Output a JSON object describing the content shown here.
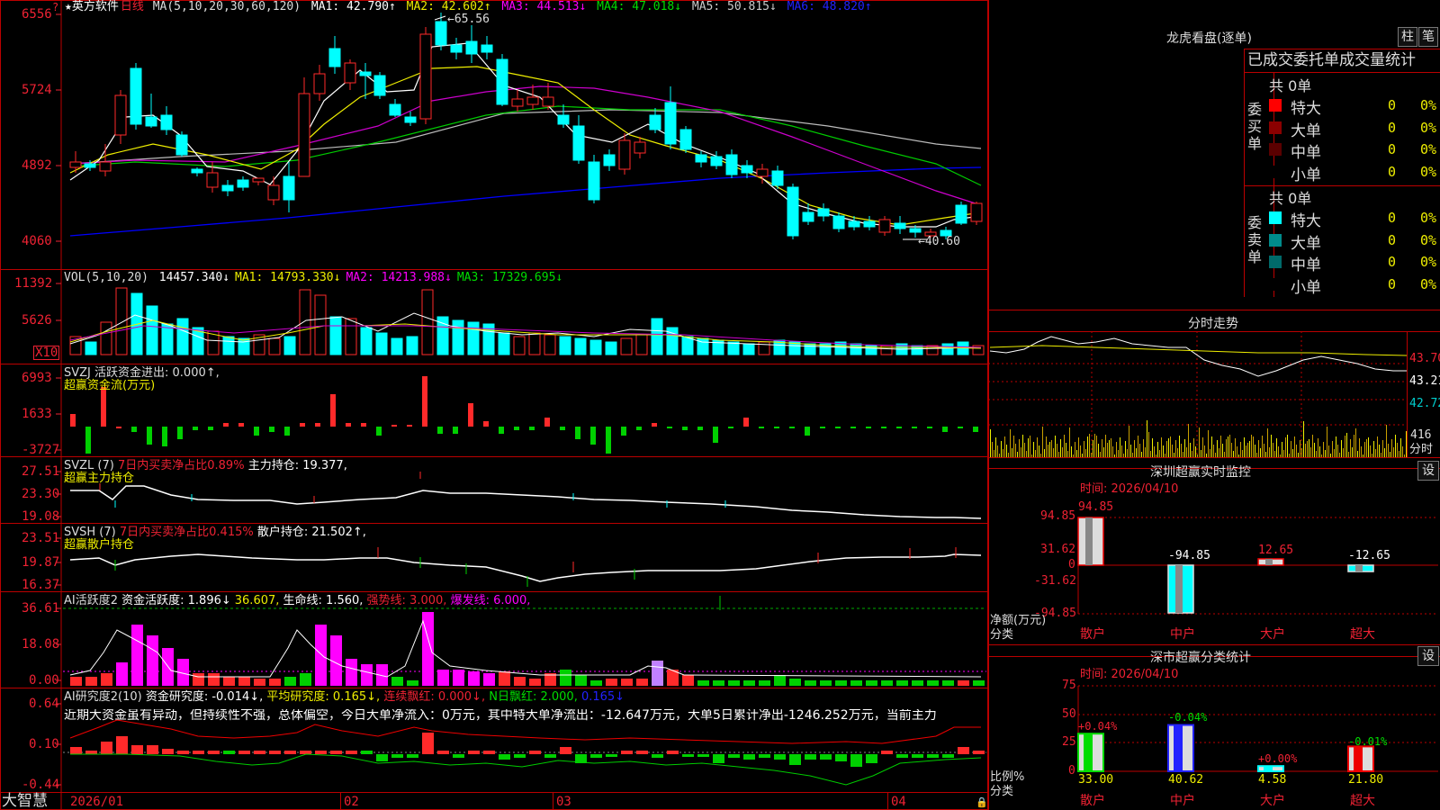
{
  "header": {
    "star": "★",
    "stock_name": "英方软件",
    "period": "日线",
    "ma_text": "MA(5,10,20,30,60,120)",
    "ma1": "MA1: 42.790↑",
    "ma2": "MA2: 42.602↑",
    "ma3": "MA3: 44.513↓",
    "ma4": "MA4: 47.018↓",
    "ma5": "MA5: 50.815↓",
    "ma6": "MA6: 48.820↑",
    "price_high_label": "65.56",
    "price_low_label": "40.60"
  },
  "price_axis": [
    "6556",
    "5724",
    "4892",
    "4060"
  ],
  "vol": {
    "title": "VOL(5,10,20)",
    "value": "14457.340↓",
    "ma1": "MA1: 14793.330↓",
    "ma2": "MA2: 14213.988↓",
    "ma3": "MA3: 17329.695↓",
    "axis": [
      "11392",
      "5626"
    ],
    "unit": "X10"
  },
  "svzj": {
    "title": "SVZJ  活跃资金进出: 0.000↑,",
    "subtitle": "超赢资金流(万元)",
    "axis": [
      "6993",
      "1633",
      "-3727"
    ]
  },
  "svzl": {
    "title": "SVZL (7)",
    "highlight": "7日内买卖净占比0.89%",
    "value": "主力持仓: 19.377,",
    "subtitle": "超赢主力持仓",
    "axis": [
      "27.51",
      "23.30",
      "19.08"
    ]
  },
  "svsh": {
    "title": "SVSH (7)",
    "highlight": "7日内买卖净占比0.415%",
    "value": "散户持仓: 21.502↑,",
    "subtitle": "超赢散户持仓",
    "axis": [
      "23.51",
      "19.87",
      "16.37"
    ]
  },
  "ai_active": {
    "title": "AI活跃度2",
    "activity": "资金活跃度: 1.896↓",
    "v2": "36.607,",
    "life": "生命线: 1.560,",
    "strong": "强势线: 3.000,",
    "burst": "爆发线: 6.000,",
    "axis": [
      "36.61",
      "18.08",
      "0.00"
    ]
  },
  "ai_research": {
    "title": "AI研究度2(10)",
    "research": "资金研究度: -0.014↓,",
    "avg": "平均研究度: 0.165↓,",
    "cont": "连续飘红: 0.000↓,",
    "nday": "N日飘红: 2.000,",
    "last": "0.165↓",
    "comment": "近期大资金虽有异动，但持续性不强，总体偏空，今日大单净流入：0万元，其中特大单净流出：-12.647万元，大单5日累计净出-1246.252万元，当前主力",
    "axis": [
      "0.64",
      "0.10",
      "-0.44"
    ]
  },
  "date_axis": [
    "2026/01",
    "02",
    "03",
    "04"
  ],
  "logo": "大智慧",
  "right_panel": {
    "lhb_title": "龙虎看盘(逐单)",
    "btn_zhu": "柱",
    "btn_bi": "笔",
    "stat_title": "已成交委托单成交量统计",
    "buy_label": "委买单",
    "sell_label": "委卖单",
    "buy_total": "共 0单",
    "sell_total": "共 0单",
    "buy_rows": [
      {
        "name": "特大",
        "count": "0",
        "pct": "0%",
        "color": "#ff0000"
      },
      {
        "name": "大单",
        "count": "0",
        "pct": "0%",
        "color": "#8b0000"
      },
      {
        "name": "中单",
        "count": "0",
        "pct": "0%",
        "color": "#5a0000"
      },
      {
        "name": "小单",
        "count": "0",
        "pct": "0%",
        "color": "#000000"
      }
    ],
    "sell_rows": [
      {
        "name": "特大",
        "count": "0",
        "pct": "0%",
        "color": "#00ffff"
      },
      {
        "name": "大单",
        "count": "0",
        "pct": "0%",
        "color": "#008b8b"
      },
      {
        "name": "中单",
        "count": "0",
        "pct": "0%",
        "color": "#006a6a"
      },
      {
        "name": "小单",
        "count": "0",
        "pct": "0%",
        "color": "#000000"
      }
    ],
    "fs_title": "分时走势",
    "fs_axis": [
      "43.70",
      "43.21",
      "42.72"
    ],
    "fs_vol": "416",
    "fs_label": "分时",
    "monitor_title": "深圳超赢实时监控",
    "monitor_btn": "设",
    "monitor_time": "时间: 2026/04/10",
    "monitor_axis": [
      "94.85",
      "31.62",
      "0",
      "-31.62",
      "-94.85"
    ],
    "monitor_ylabel1": "净额(万元)",
    "monitor_ylabel2": "分类",
    "monitor_cats": [
      "散户",
      "中户",
      "大户",
      "超大"
    ],
    "monitor_values": [
      "94.85",
      "-94.85",
      "12.65",
      "-12.65"
    ],
    "class_title": "深市超赢分类统计",
    "class_btn": "设",
    "class_time": "时间: 2026/04/10",
    "class_axis": [
      "75",
      "50",
      "25",
      "0"
    ],
    "class_ylabel1": "比例%",
    "class_ylabel2": "分类",
    "class_cats": [
      "散户",
      "中户",
      "大户",
      "超大"
    ],
    "class_values": [
      "33.00",
      "40.62",
      "4.58",
      "21.80"
    ],
    "class_changes": [
      "+0.04%",
      "-0.04%",
      "+0.00%",
      "-0.01%"
    ]
  }
}
